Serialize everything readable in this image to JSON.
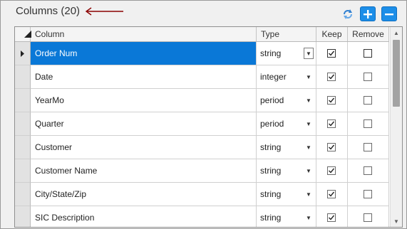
{
  "panel": {
    "title": "Columns (20)"
  },
  "toolbar": {
    "refresh_icon": "refresh-icon",
    "add_icon": "plus-icon",
    "remove_icon": "minus-icon",
    "accent": "#1c8ee8"
  },
  "grid": {
    "headers": {
      "column": "Column",
      "type": "Type",
      "keep": "Keep",
      "remove": "Remove"
    },
    "rows": [
      {
        "column": "Order Num",
        "type": "string",
        "keep": true,
        "remove": false,
        "selected": true
      },
      {
        "column": "Date",
        "type": "integer",
        "keep": true,
        "remove": false,
        "selected": false
      },
      {
        "column": "YearMo",
        "type": "period",
        "keep": true,
        "remove": false,
        "selected": false
      },
      {
        "column": "Quarter",
        "type": "period",
        "keep": true,
        "remove": false,
        "selected": false
      },
      {
        "column": "Customer",
        "type": "string",
        "keep": true,
        "remove": false,
        "selected": false
      },
      {
        "column": "Customer Name",
        "type": "string",
        "keep": true,
        "remove": false,
        "selected": false
      },
      {
        "column": "City/State/Zip",
        "type": "string",
        "keep": true,
        "remove": false,
        "selected": false
      },
      {
        "column": "SIC Description",
        "type": "string",
        "keep": true,
        "remove": false,
        "selected": false
      }
    ],
    "selection_color": "#0a78d7"
  }
}
